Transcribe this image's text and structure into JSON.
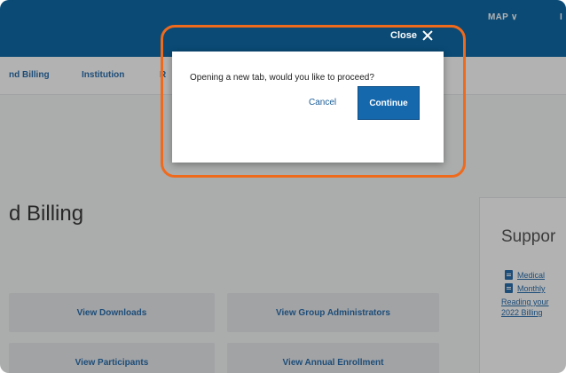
{
  "topbar": {
    "menus": [
      "MAP",
      "I"
    ]
  },
  "subnav": {
    "items": [
      "nd Billing",
      "Institution",
      "R"
    ]
  },
  "page": {
    "heading": "d Billing"
  },
  "tiles": [
    "View Downloads",
    "View Group Administrators",
    "View Participants",
    "View Annual Enrollment"
  ],
  "support": {
    "title": "Suppor",
    "links": [
      "Medical",
      "Monthly",
      "Reading your",
      "2022 Billing"
    ]
  },
  "modal": {
    "close_label": "Close",
    "message": "Opening a new tab, would you like to proceed?",
    "cancel_label": "Cancel",
    "continue_label": "Continue"
  },
  "colors": {
    "brand_blue": "#0f6aa8",
    "highlight_orange": "#f06a1c"
  }
}
